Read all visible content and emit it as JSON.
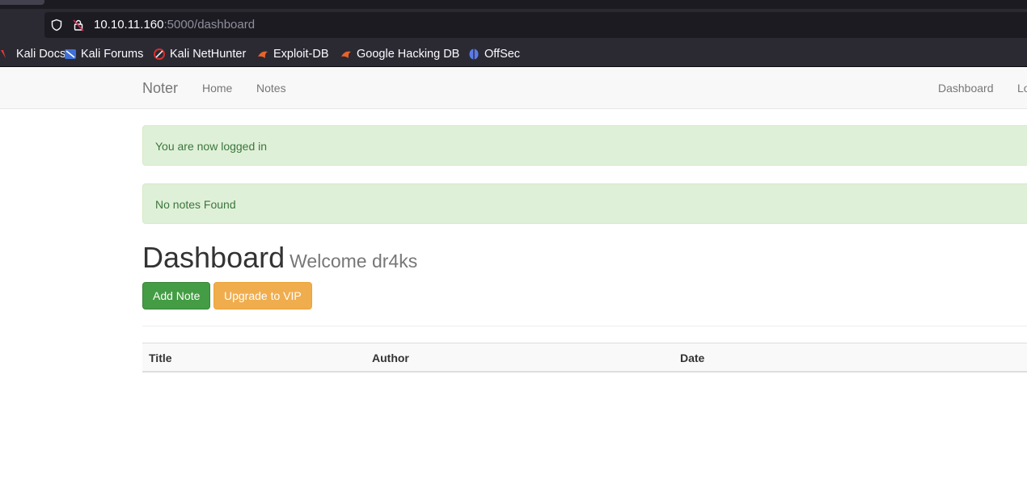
{
  "browser": {
    "url_host": "10.10.11.160",
    "url_path": ":5000/dashboard",
    "bookmarks": [
      {
        "label": "Kali Docs",
        "icon": "kali-docs-icon",
        "color": "#e53935"
      },
      {
        "label": "Kali Forums",
        "icon": "kali-forums-icon",
        "color": "#3f6fd6"
      },
      {
        "label": "Kali NetHunter",
        "icon": "kali-nethunter-icon",
        "color": "#d32f2f"
      },
      {
        "label": "Exploit-DB",
        "icon": "exploit-db-icon",
        "color": "#e8632a"
      },
      {
        "label": "Google Hacking DB",
        "icon": "ghdb-icon",
        "color": "#e8632a"
      },
      {
        "label": "OffSec",
        "icon": "offsec-icon",
        "color": "#5b7be8"
      }
    ]
  },
  "navbar": {
    "brand": "Noter",
    "links": [
      "Home",
      "Notes"
    ],
    "right_links": [
      "Dashboard",
      "Logout"
    ]
  },
  "alerts": [
    "You are now logged in",
    "No notes Found"
  ],
  "dashboard": {
    "title": "Dashboard",
    "welcome": "Welcome dr4ks",
    "add_note_label": "Add Note",
    "upgrade_label": "Upgrade to VIP"
  },
  "table": {
    "headers": [
      "Title",
      "Author",
      "Date"
    ]
  },
  "colors": {
    "success": "#449d44",
    "warning": "#f0ad4e",
    "alert_bg": "#dff0d8",
    "alert_text": "#3c763d"
  }
}
